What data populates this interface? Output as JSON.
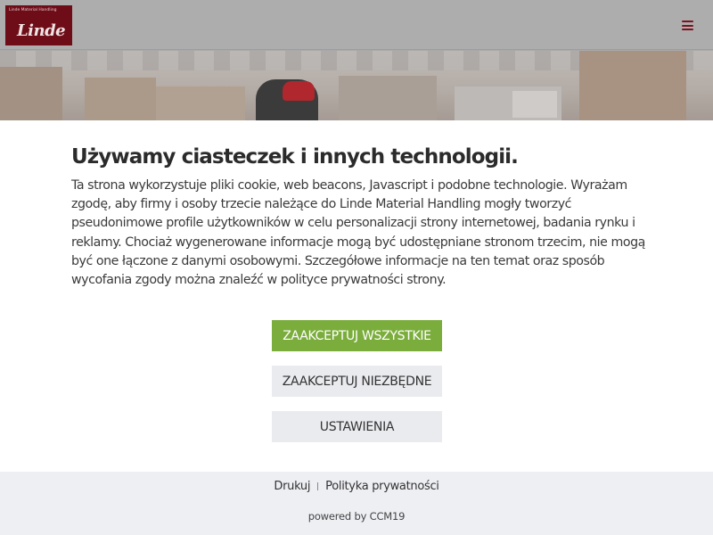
{
  "header": {
    "logo_subtitle": "Linde Material Handling",
    "logo_wordmark": "Linde",
    "menu_icon": "hamburger-menu-icon",
    "brand_color": "#6e0d18"
  },
  "cookie_dialog": {
    "title": "Używamy ciasteczek i innych technologii.",
    "body": "Ta strona wykorzystuje pliki cookie, web beacons, Javascript i podobne technologie. Wyrażam zgodę, aby firmy i osoby trzecie należące do Linde Material Handling mogły tworzyć pseudonimowe profile użytkowników w celu personalizacji strony internetowej, badania rynku i reklamy. Chociaż wygenerowane informacje mogą być udostępniane stronom trzecim, nie mogą być one łączone z danymi osobowymi. Szczegółowe informacje na ten temat oraz sposób wycofania zgody można znaleźć w polityce prywatności strony.",
    "buttons": {
      "accept_all": "ZAAKCEPTUJ WSZYSTKIE",
      "accept_necessary": "ZAAKCEPTUJ NIEZBĘDNE",
      "settings": "USTAWIENIA"
    },
    "accent_color": "#7bad3c"
  },
  "footer": {
    "print_link": "Drukuj",
    "privacy_link": "Polityka prywatności",
    "powered_by": "powered by CCM19"
  }
}
